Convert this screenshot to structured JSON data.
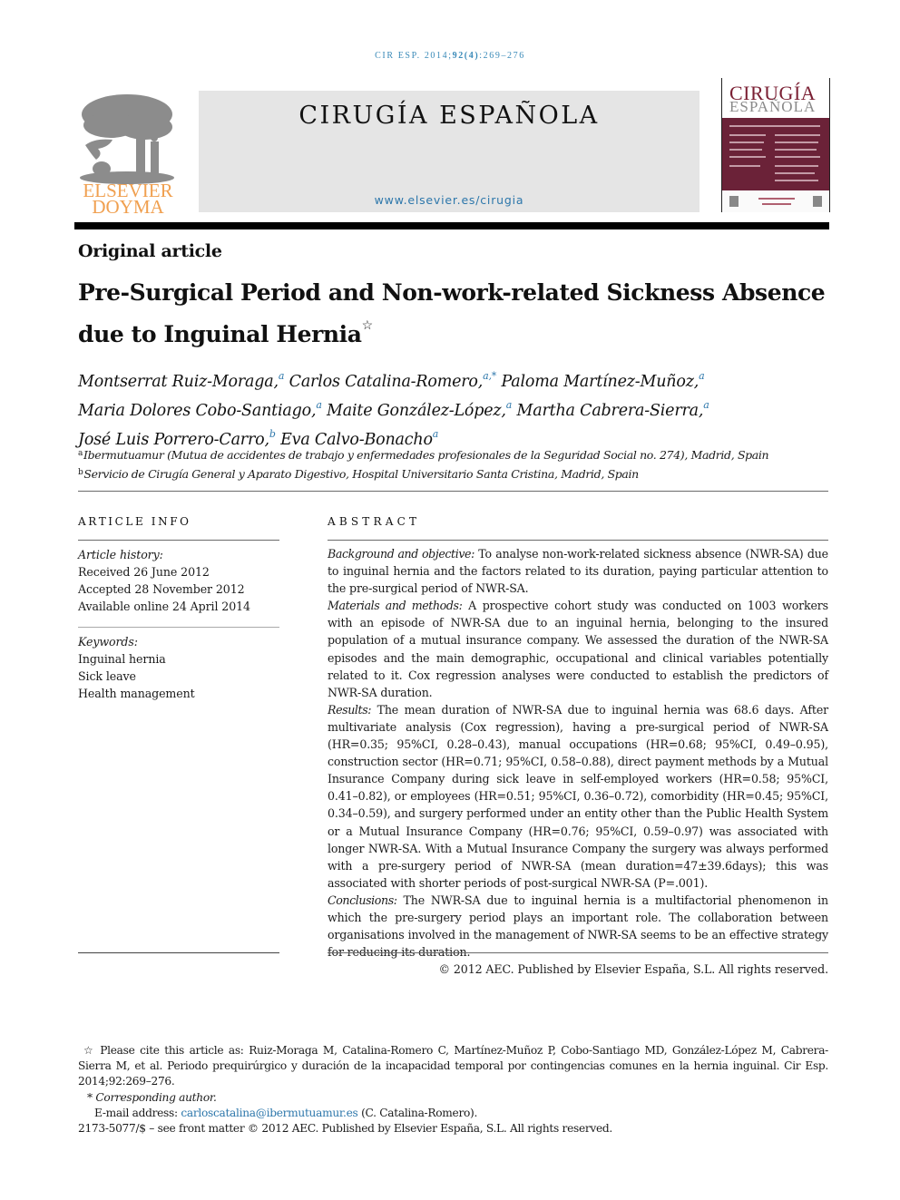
{
  "running_head": {
    "journal": "CIR ESP.",
    "year": "2014;",
    "volume_issue": "92(4)",
    "pages": ":269–276"
  },
  "header": {
    "publisher_logo": {
      "line1": "ELSEVIER",
      "line2": "DOYMA",
      "color": "#f0a050"
    },
    "journal_title": "CIRUGÍA ESPAÑOLA",
    "journal_url": "www.elsevier.es/cirugia",
    "cover": {
      "title_line1": "CIRUGÍA",
      "title_line2": "ESPAÑOLA",
      "band_color": "#6b2238"
    }
  },
  "article": {
    "type": "Original article",
    "title": "Pre-Surgical Period and Non-work-related Sickness Absence due to Inguinal Hernia",
    "title_note_mark": "☆",
    "authors": [
      {
        "name": "Montserrat Ruiz-Moraga,",
        "aff": "a"
      },
      {
        "name": "Carlos Catalina-Romero,",
        "aff": "a,*"
      },
      {
        "name": "Paloma Martínez-Muñoz,",
        "aff": "a"
      },
      {
        "name": "Maria Dolores Cobo-Santiago,",
        "aff": "a"
      },
      {
        "name": "Maite González-López,",
        "aff": "a"
      },
      {
        "name": "Martha Cabrera-Sierra,",
        "aff": "a"
      },
      {
        "name": "José Luis Porrero-Carro,",
        "aff": "b"
      },
      {
        "name": "Eva Calvo-Bonacho",
        "aff": "a"
      }
    ],
    "affiliations": [
      {
        "mark": "a",
        "text": "Ibermutuamur (Mutua de accidentes de trabajo y enfermedades profesionales de la Seguridad Social no. 274), Madrid, Spain"
      },
      {
        "mark": "b",
        "text": "Servicio de Cirugía General y Aparato Digestivo, Hospital Universitario Santa Cristina, Madrid, Spain"
      }
    ]
  },
  "article_info": {
    "heading": "ARTICLE INFO",
    "history_label": "Article history:",
    "history": [
      "Received 26 June 2012",
      "Accepted 28 November 2012",
      "Available online 24 April 2014"
    ],
    "keywords_label": "Keywords:",
    "keywords": [
      "Inguinal hernia",
      "Sick leave",
      "Health management"
    ]
  },
  "abstract": {
    "heading": "ABSTRACT",
    "sections": [
      {
        "label": "Background and objective:",
        "text": "To analyse non-work-related sickness absence (NWR-SA) due to inguinal hernia and the factors related to its duration, paying particular attention to the pre-surgical period of NWR-SA."
      },
      {
        "label": "Materials and methods:",
        "text": "A prospective cohort study was conducted on 1003 workers with an episode of NWR-SA due to an inguinal hernia, belonging to the insured population of a mutual insurance company. We assessed the duration of the NWR-SA episodes and the main demographic, occupational and clinical variables potentially related to it. Cox regression analyses were conducted to establish the predictors of NWR-SA duration."
      },
      {
        "label": "Results:",
        "text": "The mean duration of NWR-SA due to inguinal hernia was 68.6 days. After multivariate analysis (Cox regression), having a pre-surgical period of NWR-SA (HR=0.35; 95%CI, 0.28–0.43), manual occupations (HR=0.68; 95%CI, 0.49–0.95), construction sector (HR=0.71; 95%CI, 0.58–0.88), direct payment methods by a Mutual Insurance Company during sick leave in self-employed workers (HR=0.58; 95%CI, 0.41–0.82), or employees (HR=0.51; 95%CI, 0.36–0.72), comorbidity (HR=0.45; 95%CI, 0.34–0.59), and surgery performed under an entity other than the Public Health System or a Mutual Insurance Company (HR=0.76; 95%CI, 0.59–0.97) was associated with longer NWR-SA. With a Mutual Insurance Company the surgery was always performed with a pre-surgery period of NWR-SA (mean duration=47±39.6days); this was associated with shorter periods of post-surgical NWR-SA (P=.001)."
      },
      {
        "label": "Conclusions:",
        "text": "The NWR-SA due to inguinal hernia is a multifactorial phenomenon in which the pre-surgery period plays an important role. The collaboration between organisations involved in the management of NWR-SA seems to be an effective strategy for reducing its duration."
      }
    ],
    "copyright": "© 2012 AEC. Published by Elsevier España, S.L. All rights reserved."
  },
  "footnotes": {
    "cite_mark": "☆",
    "cite_text": "Please cite this article as: Ruiz-Moraga M, Catalina-Romero C, Martínez-Muñoz P, Cobo-Santiago MD, González-López M, Cabrera-Sierra M, et al. Periodo prequirúrgico y duración de la incapacidad temporal por contingencias comunes en la hernia inguinal. Cir Esp. 2014;92:269–276.",
    "corresponding_mark": "*",
    "corresponding_label": "Corresponding author.",
    "email_label": "E-mail address:",
    "email": "carloscatalina@ibermutuamur.es",
    "email_owner": "(C. Catalina-Romero).",
    "front_matter": "2173-5077/$ – see front matter © 2012 AEC. Published by Elsevier España, S.L. All rights reserved."
  }
}
